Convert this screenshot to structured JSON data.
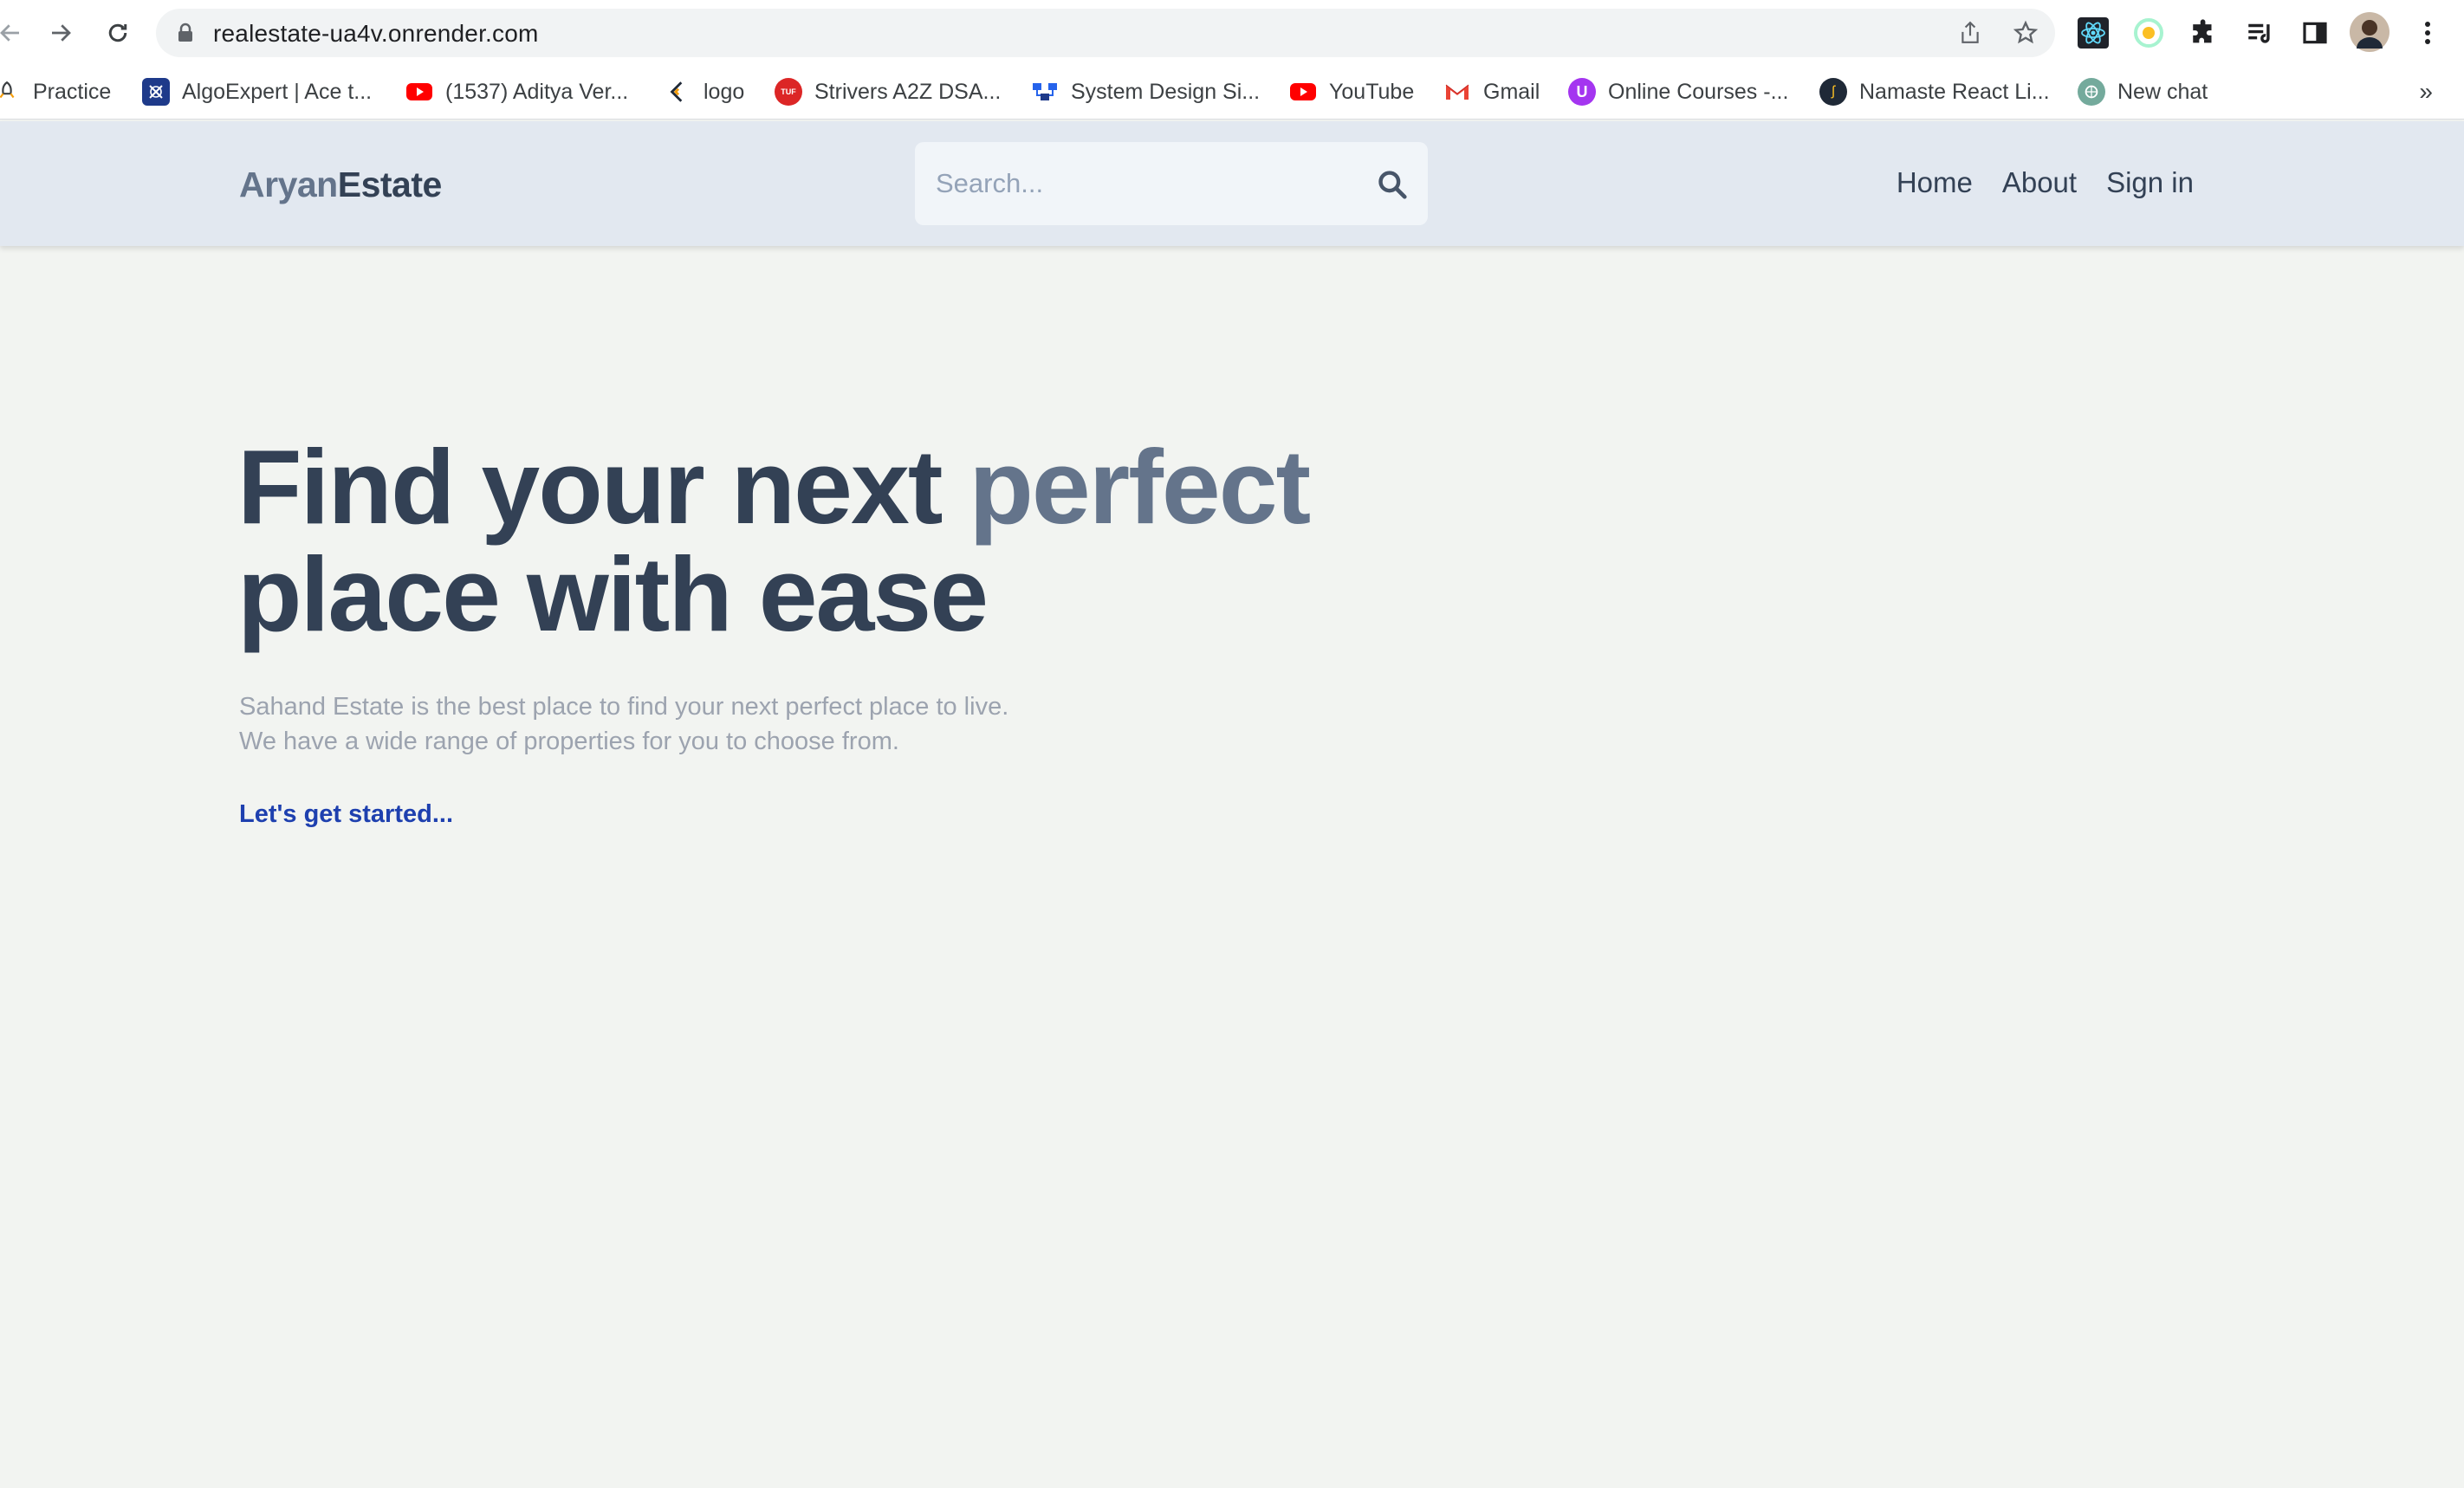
{
  "browser": {
    "url": "realestate-ua4v.onrender.com",
    "bookmarks": [
      {
        "label": "Practice",
        "icon": "rocket-icon"
      },
      {
        "label": "AlgoExpert | Ace t...",
        "icon": "algoexpert-icon"
      },
      {
        "label": "(1537) Aditya Ver...",
        "icon": "youtube-icon"
      },
      {
        "label": "logo",
        "icon": "logo-icon"
      },
      {
        "label": "Strivers A2Z DSA...",
        "icon": "tuf-icon"
      },
      {
        "label": "System Design Si...",
        "icon": "system-design-icon"
      },
      {
        "label": "YouTube",
        "icon": "youtube-icon"
      },
      {
        "label": "Gmail",
        "icon": "gmail-icon"
      },
      {
        "label": "Online Courses -...",
        "icon": "udemy-icon"
      },
      {
        "label": "Namaste React Li...",
        "icon": "namaste-icon"
      },
      {
        "label": "New chat",
        "icon": "chatgpt-icon"
      }
    ],
    "more": "»"
  },
  "header": {
    "logo_part1": "Aryan",
    "logo_part2": "Estate",
    "search_placeholder": "Search...",
    "nav": {
      "home": "Home",
      "about": "About",
      "signin": "Sign in"
    }
  },
  "hero": {
    "title_part1": "Find your next ",
    "title_accent": "perfect",
    "title_part2": "place with ease",
    "desc_line1": "Sahand Estate is the best place to find your next perfect place to live.",
    "desc_line2": "We have a wide range of properties for you to choose from.",
    "cta": "Let's get started..."
  },
  "colors": {
    "header_bg": "#e2e8f0",
    "page_bg": "#f2f4f1",
    "title": "#334155",
    "accent": "#64748b",
    "cta": "#1e40af"
  }
}
